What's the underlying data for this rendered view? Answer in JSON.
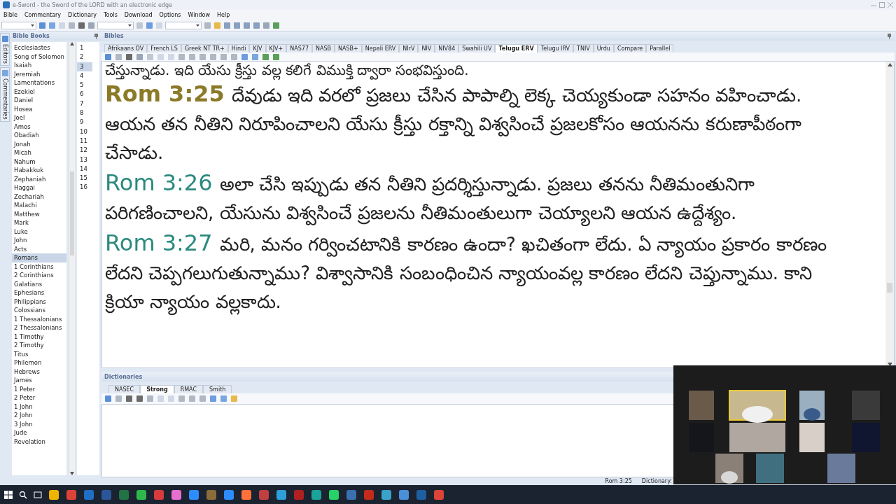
{
  "window": {
    "title": "e-Sword - the Sword of the LORD with an electronic edge"
  },
  "menu": [
    "Bible",
    "Commentary",
    "Dictionary",
    "Tools",
    "Download",
    "Options",
    "Window",
    "Help"
  ],
  "side_tabs": [
    {
      "label": "Editors"
    },
    {
      "label": "Commentaries"
    }
  ],
  "books_panel": {
    "title": "Bible Books",
    "books": [
      {
        "label": "Ecclesiastes",
        "selected": false
      },
      {
        "label": "Song of Solomon",
        "selected": false
      },
      {
        "label": "Isaiah",
        "selected": false
      },
      {
        "label": "Jeremiah",
        "selected": false
      },
      {
        "label": "Lamentations",
        "selected": false
      },
      {
        "label": "Ezekiel",
        "selected": false
      },
      {
        "label": "Daniel",
        "selected": false
      },
      {
        "label": "Hosea",
        "selected": false
      },
      {
        "label": "Joel",
        "selected": false
      },
      {
        "label": "Amos",
        "selected": false
      },
      {
        "label": "Obadiah",
        "selected": false
      },
      {
        "label": "Jonah",
        "selected": false
      },
      {
        "label": "Micah",
        "selected": false
      },
      {
        "label": "Nahum",
        "selected": false
      },
      {
        "label": "Habakkuk",
        "selected": false
      },
      {
        "label": "Zephaniah",
        "selected": false
      },
      {
        "label": "Haggai",
        "selected": false
      },
      {
        "label": "Zechariah",
        "selected": false
      },
      {
        "label": "Malachi",
        "selected": false
      },
      {
        "label": "Matthew",
        "selected": false
      },
      {
        "label": "Mark",
        "selected": false
      },
      {
        "label": "Luke",
        "selected": false
      },
      {
        "label": "John",
        "selected": false
      },
      {
        "label": "Acts",
        "selected": false
      },
      {
        "label": "Romans",
        "selected": true
      },
      {
        "label": "1 Corinthians",
        "selected": false
      },
      {
        "label": "2 Corinthians",
        "selected": false
      },
      {
        "label": "Galatians",
        "selected": false
      },
      {
        "label": "Ephesians",
        "selected": false
      },
      {
        "label": "Philippians",
        "selected": false
      },
      {
        "label": "Colossians",
        "selected": false
      },
      {
        "label": "1 Thessalonians",
        "selected": false
      },
      {
        "label": "2 Thessalonians",
        "selected": false
      },
      {
        "label": "1 Timothy",
        "selected": false
      },
      {
        "label": "2 Timothy",
        "selected": false
      },
      {
        "label": "Titus",
        "selected": false
      },
      {
        "label": "Philemon",
        "selected": false
      },
      {
        "label": "Hebrews",
        "selected": false
      },
      {
        "label": "James",
        "selected": false
      },
      {
        "label": "1 Peter",
        "selected": false
      },
      {
        "label": "2 Peter",
        "selected": false
      },
      {
        "label": "1 John",
        "selected": false
      },
      {
        "label": "2 John",
        "selected": false
      },
      {
        "label": "3 John",
        "selected": false
      },
      {
        "label": "Jude",
        "selected": false
      },
      {
        "label": "Revelation",
        "selected": false
      }
    ],
    "chapters": [
      {
        "label": "1",
        "selected": false
      },
      {
        "label": "2",
        "selected": false
      },
      {
        "label": "3",
        "selected": true
      },
      {
        "label": "4",
        "selected": false
      },
      {
        "label": "5",
        "selected": false
      },
      {
        "label": "6",
        "selected": false
      },
      {
        "label": "7",
        "selected": false
      },
      {
        "label": "8",
        "selected": false
      },
      {
        "label": "9",
        "selected": false
      },
      {
        "label": "10",
        "selected": false
      },
      {
        "label": "11",
        "selected": false
      },
      {
        "label": "12",
        "selected": false
      },
      {
        "label": "13",
        "selected": false
      },
      {
        "label": "14",
        "selected": false
      },
      {
        "label": "15",
        "selected": false
      },
      {
        "label": "16",
        "selected": false
      }
    ]
  },
  "bibles_panel": {
    "title": "Bibles",
    "tabs": [
      {
        "label": "Afrikaans OV",
        "selected": false
      },
      {
        "label": "French LS",
        "selected": false
      },
      {
        "label": "Greek NT TR+",
        "selected": false
      },
      {
        "label": "Hindi",
        "selected": false
      },
      {
        "label": "KJV",
        "selected": false
      },
      {
        "label": "KJV+",
        "selected": false
      },
      {
        "label": "NAS77",
        "selected": false
      },
      {
        "label": "NASB",
        "selected": false
      },
      {
        "label": "NASB+",
        "selected": false
      },
      {
        "label": "Nepali ERV",
        "selected": false
      },
      {
        "label": "NIrV",
        "selected": false
      },
      {
        "label": "NIV",
        "selected": false
      },
      {
        "label": "NIV84",
        "selected": false
      },
      {
        "label": "Swahili UV",
        "selected": false
      },
      {
        "label": "Telugu ERV",
        "selected": true
      },
      {
        "label": "Telugu IRV",
        "selected": false
      },
      {
        "label": "TNIV",
        "selected": false
      },
      {
        "label": "Urdu",
        "selected": false
      },
      {
        "label": "Compare",
        "selected": false
      },
      {
        "label": "Parallel",
        "selected": false
      }
    ],
    "lead_in": "చేస్తున్నాడు. ఇది యేసు క్రీస్తు వల్ల కలిగే విముక్తి ద్వారా సంభవిస్తుంది.",
    "verses": [
      {
        "ref": "Rom 3:25",
        "text": "దేవుడు ఇది వరలో ప్రజలు చేసిన పాపాల్ని లెక్క చెయ్యకుండా సహనం వహించాడు. ఆయన తన నీతిని నిరూపించాలని యేసు క్రీస్తు రక్తాన్ని విశ్వసించే ప్రజలకోసం ఆయనను కరుణాపీఠంగా చేసాడు.",
        "current": true
      },
      {
        "ref": "Rom 3:26",
        "text": "అలా చేసి ఇప్పుడు తన నీతిని ప్రదర్శిస్తున్నాడు. ప్రజలు తనను నీతిమంతునిగా పరిగణించాలని, యేసును విశ్వసించే ప్రజలను నీతిమంతులుగా చెయ్యాలని ఆయన ఉద్దేశ్యం.",
        "current": false
      },
      {
        "ref": "Rom 3:27",
        "text": "మరి, మనం గర్వించటానికి కారణం ఉందా? ఖచితంగా లేదు. ఏ న్యాయం ప్రకారం కారణం లేదని చెప్పగలుగుతున్నాము? విశ్వాసానికి సంబంధించిన న్యాయంవల్ల కారణం లేదని చెప్తున్నాము. కాని క్రియా న్యాయం వల్లకాదు.",
        "current": false
      }
    ]
  },
  "dictionaries_panel": {
    "title": "Dictionaries",
    "tabs": [
      {
        "label": "NASEC",
        "selected": false
      },
      {
        "label": "Strong",
        "selected": true
      },
      {
        "label": "RMAC",
        "selected": false
      },
      {
        "label": "Smith",
        "selected": false
      }
    ]
  },
  "status_bar": {
    "reference": "Rom 3:25",
    "dictionary": "Dictionary:"
  }
}
